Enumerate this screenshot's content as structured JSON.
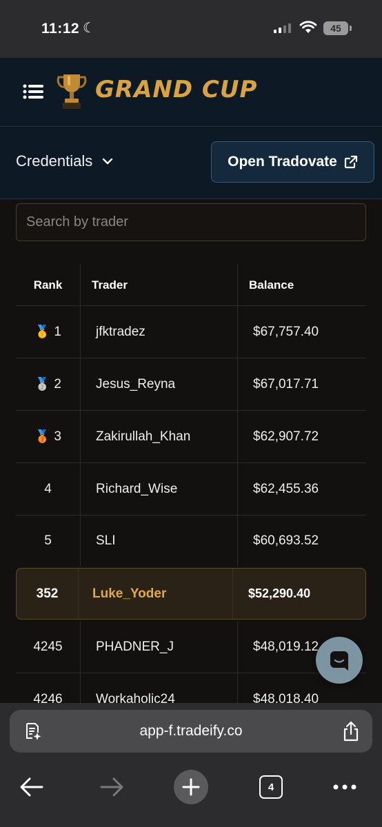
{
  "status_bar": {
    "time": "11:12",
    "battery": "45"
  },
  "header": {
    "brand": "GRAND CUP"
  },
  "credentials": {
    "label": "Credentials",
    "open_button": "Open Tradovate"
  },
  "search": {
    "placeholder": "Search by trader"
  },
  "table": {
    "headers": {
      "rank": "Rank",
      "trader": "Trader",
      "balance": "Balance"
    },
    "rows": [
      {
        "medal": "gold-medal-icon",
        "rank": "1",
        "trader": "jfktradez",
        "balance": "$67,757.40"
      },
      {
        "medal": "silver-medal-icon",
        "rank": "2",
        "trader": "Jesus_Reyna",
        "balance": "$67,017.71"
      },
      {
        "medal": "bronze-medal-icon",
        "rank": "3",
        "trader": "Zakirullah_Khan",
        "balance": "$62,907.72"
      },
      {
        "rank": "4",
        "trader": "Richard_Wise",
        "balance": "$62,455.36"
      },
      {
        "rank": "5",
        "trader": "SLI",
        "balance": "$60,693.52"
      }
    ],
    "current_user": {
      "rank": "352",
      "trader": "Luke_Yoder",
      "balance": "$52,290.40"
    },
    "more_rows": [
      {
        "rank": "4245",
        "trader": "PHADNER_J",
        "balance": "$48,019.12"
      },
      {
        "rank": "4246",
        "trader": "Workaholic24",
        "balance": "$48,018.40"
      }
    ]
  },
  "browser": {
    "url": "app-f.tradeify.co",
    "tab_count": "4"
  },
  "colors": {
    "accent": "#d9a243",
    "header_bg": "#0d1a26",
    "page_bg": "#131110",
    "highlight_row": "#2a2216"
  }
}
